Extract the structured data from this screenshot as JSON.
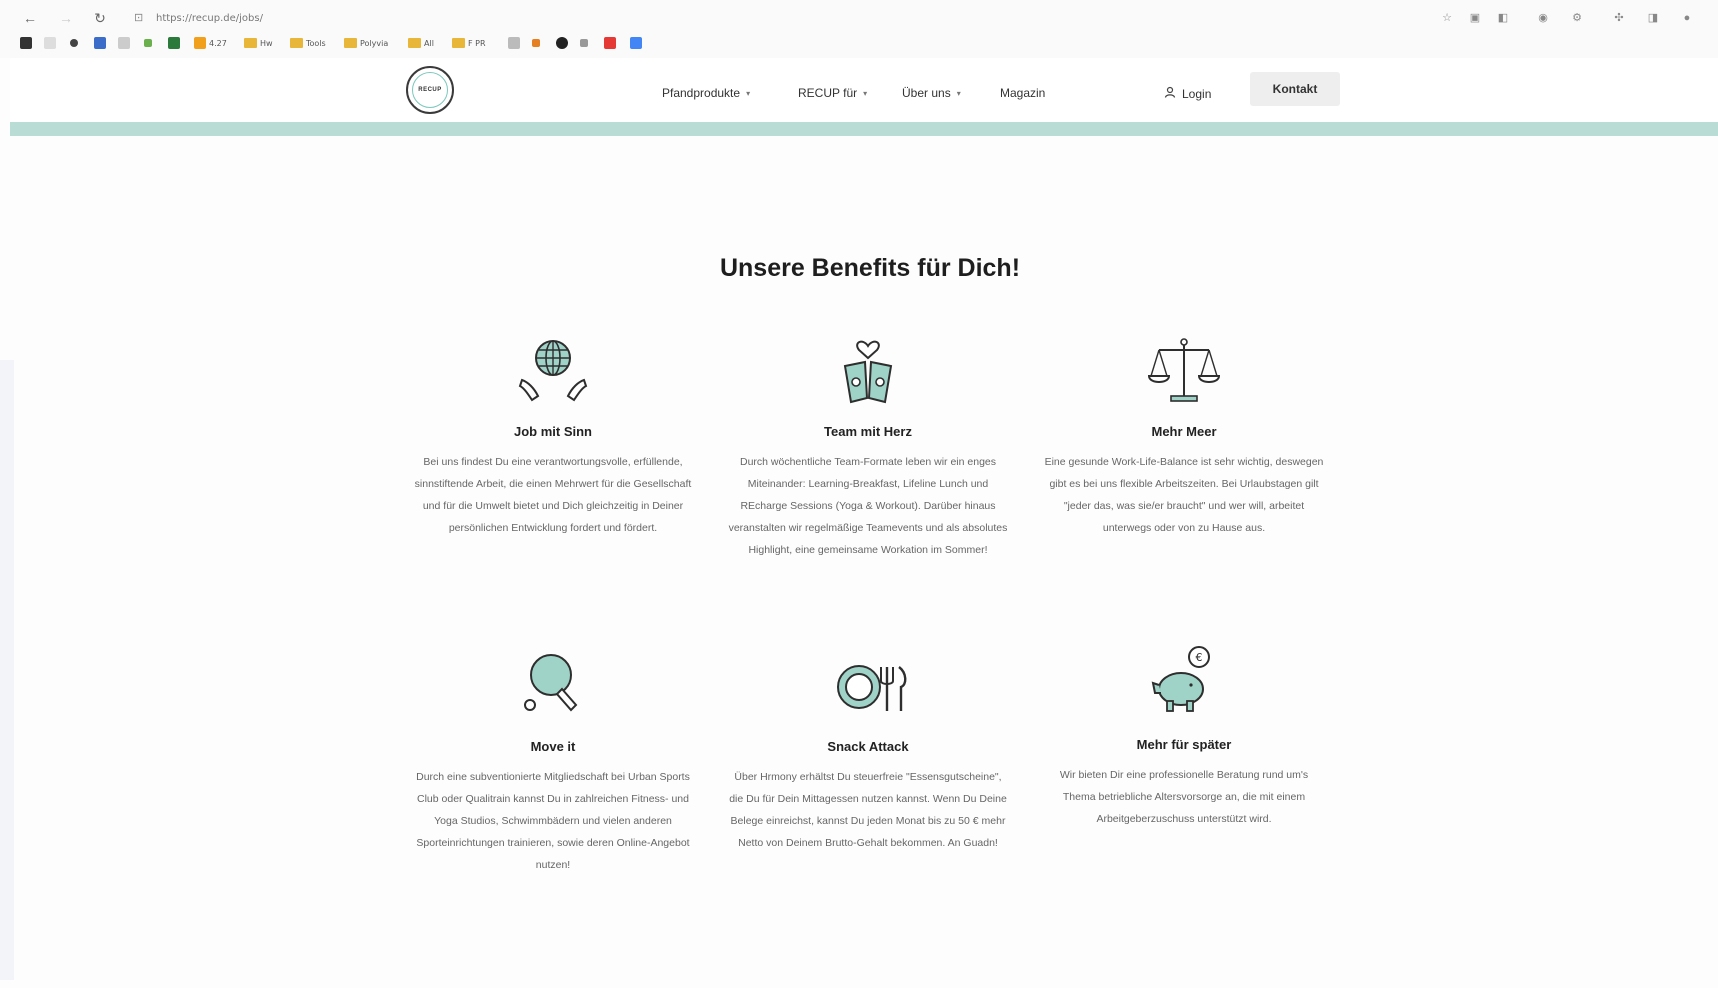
{
  "browser": {
    "url": "https://recup.de/jobs/",
    "bookmarks": [
      "4.27",
      "Hw",
      "Tools",
      "Polyvia",
      "All",
      "F PR"
    ]
  },
  "header": {
    "logo_text": "RECUP",
    "menu": [
      {
        "label": "Pfandprodukte",
        "has_dropdown": true
      },
      {
        "label": "RECUP für",
        "has_dropdown": true
      },
      {
        "label": "Über uns",
        "has_dropdown": true
      },
      {
        "label": "Magazin",
        "has_dropdown": false
      }
    ],
    "login_label": "Login",
    "contact_label": "Kontakt"
  },
  "colors": {
    "accent": "#b9ddd5",
    "icon_fill": "#9fd3c7",
    "icon_stroke": "#2e2e2e"
  },
  "main": {
    "heading": "Unsere Benefits für Dich!",
    "benefits": [
      {
        "icon": "globe-hands-icon",
        "title": "Job mit Sinn",
        "description": "Bei uns findest Du eine verantwortungsvolle, erfüllende, sinnstiftende Arbeit, die einen Mehrwert für die Gesellschaft und für die Umwelt bietet und Dich gleichzeitig in Deiner persönlichen Entwicklung fordert und fördert."
      },
      {
        "icon": "cups-heart-icon",
        "title": "Team mit Herz",
        "description": "Durch wöchentliche Team-Formate leben wir ein enges Miteinander: Learning-Breakfast, Lifeline Lunch und REcharge Sessions (Yoga & Workout). Darüber hinaus veranstalten wir regelmäßige Teamevents und als absolutes Highlight, eine gemeinsame Workation im Sommer!"
      },
      {
        "icon": "scale-icon",
        "title": "Mehr Meer",
        "description": "Eine gesunde Work-Life-Balance ist sehr wichtig, deswegen gibt es bei uns flexible Arbeitszeiten. Bei Urlaubstagen gilt \"jeder das, was sie/er braucht\" und wer will, arbeitet unterwegs oder von zu Hause aus."
      },
      {
        "icon": "ping-pong-icon",
        "title": "Move it",
        "description": "Durch eine subventionierte Mitgliedschaft bei Urban Sports Club oder Qualitrain kannst Du in zahlreichen Fitness- und Yoga Studios, Schwimmbädern und vielen anderen Sporteinrichtungen trainieren, sowie deren Online-Angebot nutzen!"
      },
      {
        "icon": "plate-cutlery-icon",
        "title": "Snack Attack",
        "description": "Über Hrmony erhältst Du steuerfreie \"Essensgutscheine\", die Du für Dein Mittagessen nutzen kannst. Wenn Du Deine Belege einreichst, kannst Du jeden Monat bis zu 50 € mehr Netto von Deinem Brutto-Gehalt bekommen. An Guadn!"
      },
      {
        "icon": "piggy-bank-icon",
        "title": "Mehr für später",
        "description": "Wir bieten Dir eine professionelle Beratung rund um's Thema betriebliche Altersvorsorge an, die mit einem Arbeitgeberzuschuss unterstützt wird."
      }
    ]
  }
}
